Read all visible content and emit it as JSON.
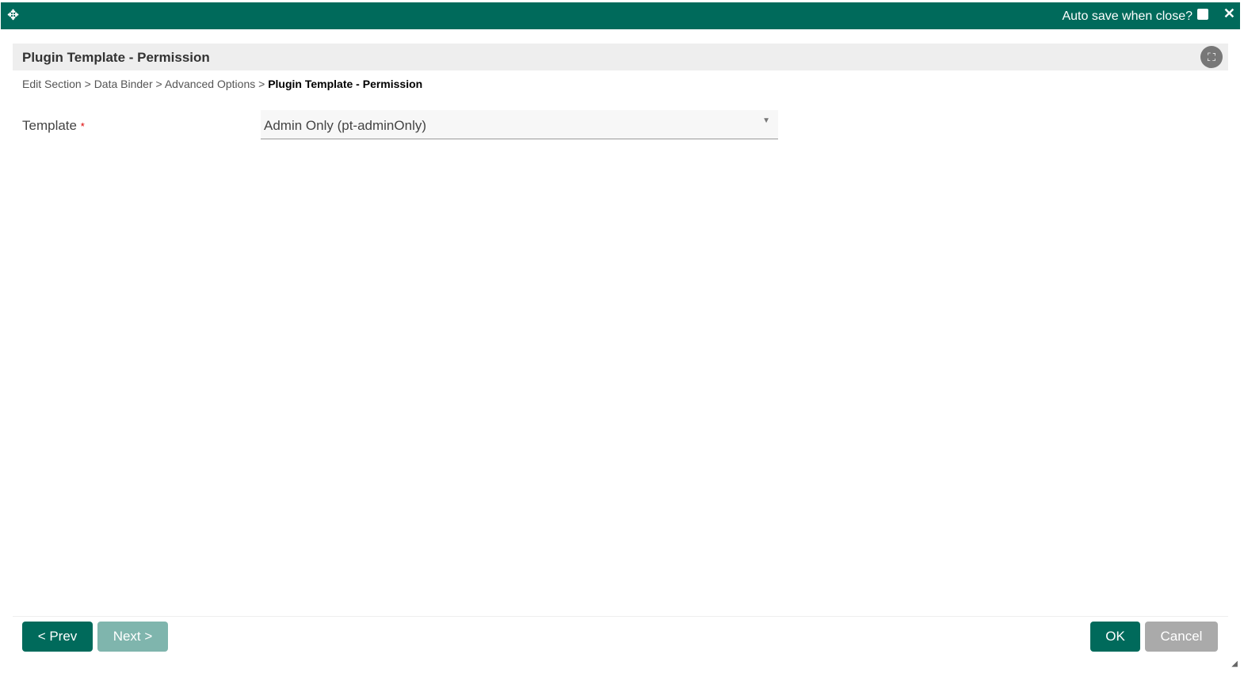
{
  "titlebar": {
    "move_icon": "✥",
    "autosave_label": "Auto save when close?",
    "autosave_checked": false,
    "close_icon": "✕"
  },
  "header": {
    "title": "Plugin Template - Permission",
    "fullscreen_icon": "⛶"
  },
  "breadcrumb": {
    "items": [
      "Edit Section",
      "Data Binder",
      "Advanced Options"
    ],
    "separator": ">",
    "current": "Plugin Template - Permission"
  },
  "form": {
    "template_label": "Template",
    "required_mark": "*",
    "template_value": "Admin Only (pt-adminOnly)",
    "arrow": "▼"
  },
  "footer": {
    "prev": "< Prev",
    "next": "Next >",
    "ok": "OK",
    "cancel": "Cancel"
  },
  "colors": {
    "primary": "#006a5b",
    "disabled_primary": "#7fb5ad",
    "cancel": "#aaaaaa"
  }
}
